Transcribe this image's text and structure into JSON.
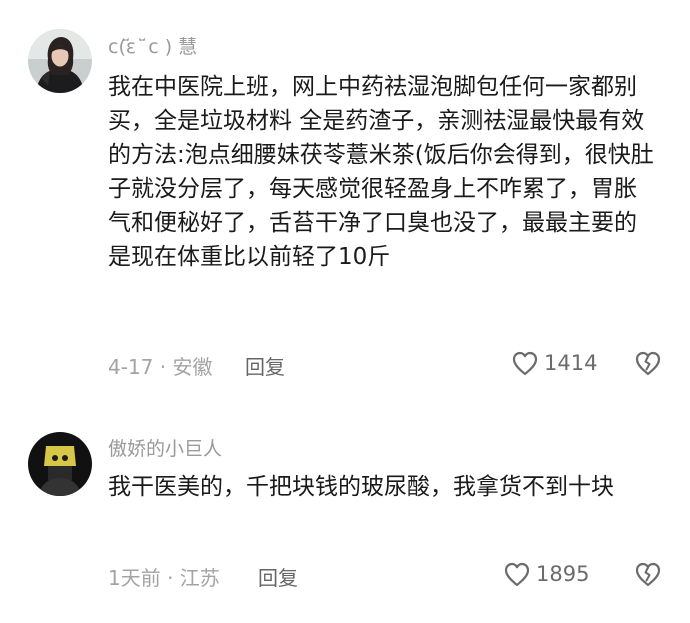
{
  "comments": [
    {
      "username": "c(꙼̈ε ꙼̈ c ) 慧",
      "text": "我在中医院上班，网上中药祛湿泡脚包任何一家都别买，全是垃圾材料 全是药渣子，亲测祛湿最快最有效的方法:泡点细腰妹茯苓薏米茶(饭后你会得到，很快肚子就没分层了，每天感觉很轻盈身上不咋累了，胃胀气和便秘好了，舌苔干净了口臭也没了，最最主要的是现在体重比以前轻了10斤",
      "meta": "4-17 · 安徽",
      "reply_label": "回复",
      "like_count": "1414"
    },
    {
      "username": "傲娇的小巨人",
      "text": "我干医美的，千把块钱的玻尿酸，我拿货不到十块",
      "meta": "1天前 · 江苏",
      "reply_label": "回复",
      "like_count": "1895"
    }
  ],
  "icons": {
    "like": "heart-outline-icon",
    "dislike": "broken-heart-icon"
  },
  "colors": {
    "text_primary": "#1a1a1a",
    "text_secondary": "#9a9a9a",
    "icon": "#6b6b6b",
    "background": "#ffffff"
  }
}
